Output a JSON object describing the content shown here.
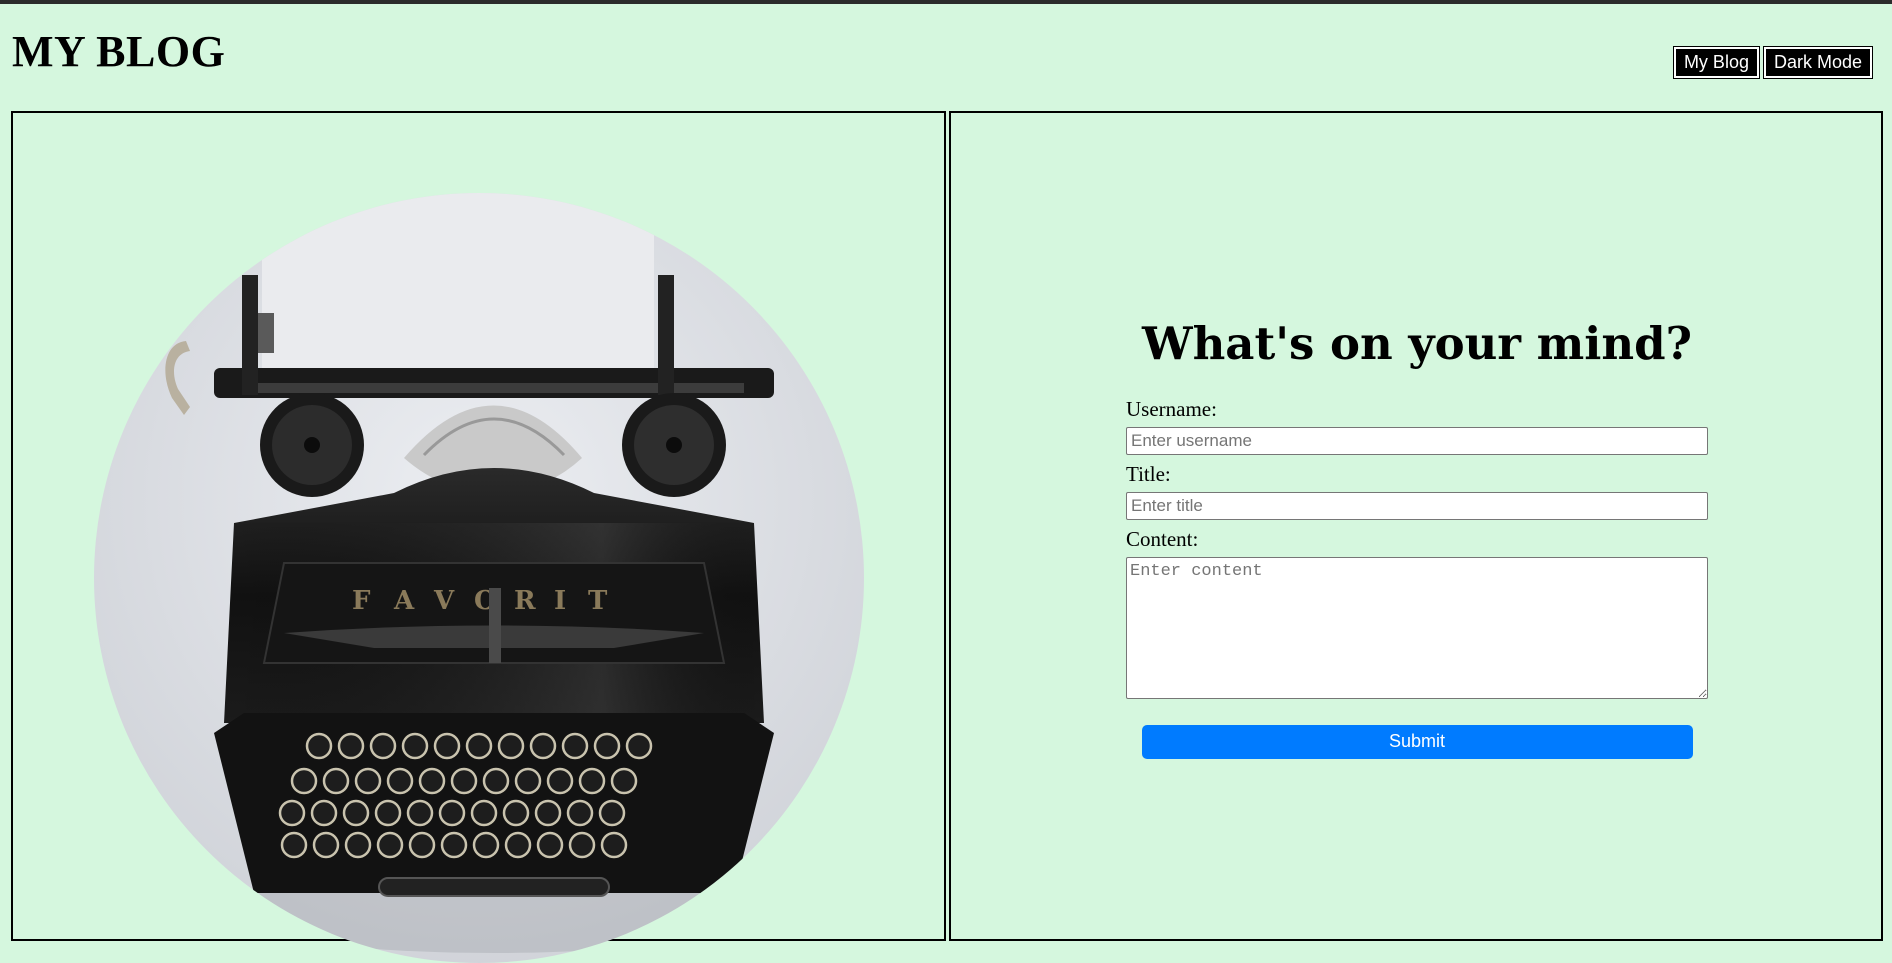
{
  "header": {
    "title": "MY BLOG",
    "nav": {
      "my_blog_label": "My Blog",
      "dark_mode_label": "Dark Mode"
    }
  },
  "left_panel": {
    "image_subject": "typewriter",
    "brand_on_image": "FAVORIT"
  },
  "form": {
    "heading": "What's on your mind?",
    "username_label": "Username:",
    "username_placeholder": "Enter username",
    "username_value": "",
    "title_label": "Title:",
    "title_placeholder": "Enter title",
    "title_value": "",
    "content_label": "Content:",
    "content_placeholder": "Enter content",
    "content_value": "",
    "submit_label": "Submit"
  },
  "colors": {
    "page_background": "#d5f7de",
    "nav_button_bg": "#000000",
    "submit_button_bg": "#007bff",
    "panel_border": "#000000"
  }
}
